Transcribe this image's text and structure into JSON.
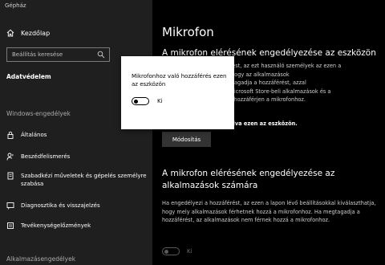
{
  "window": {
    "title": "Gépház"
  },
  "sidebar": {
    "home_label": "Kezdőlap",
    "search_placeholder": "Beállítás keresése",
    "section_title": "Adatvédelem",
    "group1_heading": "Windows-engedélyek",
    "items": [
      {
        "label": "Általános",
        "icon": "lock-icon"
      },
      {
        "label": "Beszédfelismerés",
        "icon": "speech-icon"
      },
      {
        "label": "Szabadkézi műveletek és gépelés személyre szabása",
        "icon": "pen-icon"
      },
      {
        "label": "Diagnosztika és visszajelzés",
        "icon": "feedback-icon"
      },
      {
        "label": "Tevékenységelőzmények",
        "icon": "history-icon"
      }
    ],
    "group2_heading": "Alkalmazásengedélyek"
  },
  "main": {
    "title": "Mikrofon",
    "section1": {
      "heading": "A mikrofon elérésének engedélyezése az eszközön",
      "paragraph_lines": [
        "Ha engedélyezi a hozzáférést, az ezt használó személyek az ezen a",
        "eszközön kiválaszthatják, hogy az alkalmazások",
        "hozzáférhetnek-e. Ha megtagadja a hozzáférést, azzal",
        "megakadályozza, hogy a Microsoft Store-beli alkalmazások és a",
        "legtöbb asztali alkalmazás hozzáférjen a mikrofonhoz."
      ],
      "status": "ki van kapcsolva ezen az eszközön.",
      "button_label": "Módosítás"
    },
    "section2": {
      "heading": "A mikrofon elérésének engedélyezése az alkalmazások számára",
      "paragraph": "Ha engedélyezi a hozzáférést, az ezen a lapon lévő beállításokkal kiválaszthatja, hogy mely alkalmazások férhetnek hozzá a mikrofonhoz. Ha megtagadja a hozzáférést, az alkalmazások nem férnek hozzá a mikrofonhoz.",
      "toggle_label": "Ki",
      "toggle_on": false
    }
  },
  "dialog": {
    "title": "Mikrofonhoz való hozzáférés ezen az eszközön",
    "toggle_label": "Ki",
    "toggle_on": false
  }
}
